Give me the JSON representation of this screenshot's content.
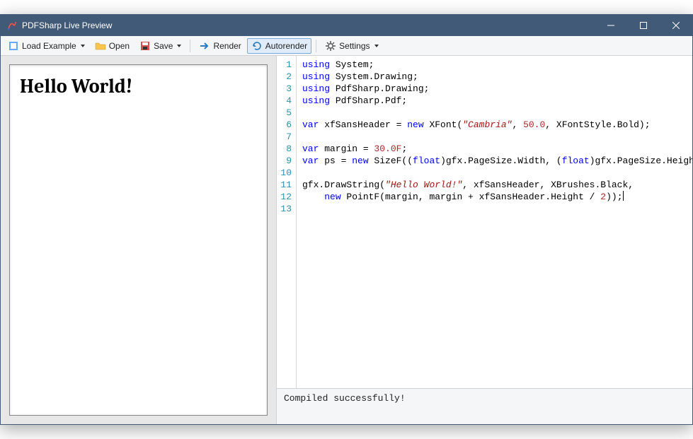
{
  "title": "PDFSharp Live Preview",
  "toolbar": {
    "load_example": "Load Example",
    "open": "Open",
    "save": "Save",
    "render": "Render",
    "autorender": "Autorender",
    "settings": "Settings"
  },
  "preview": {
    "heading": "Hello World!"
  },
  "code": {
    "lines": [
      {
        "n": 1,
        "tokens": [
          [
            "kw",
            "using"
          ],
          [
            "",
            " System;"
          ]
        ]
      },
      {
        "n": 2,
        "tokens": [
          [
            "kw",
            "using"
          ],
          [
            "",
            " System.Drawing;"
          ]
        ]
      },
      {
        "n": 3,
        "tokens": [
          [
            "kw",
            "using"
          ],
          [
            "",
            " PdfSharp.Drawing;"
          ]
        ]
      },
      {
        "n": 4,
        "tokens": [
          [
            "kw",
            "using"
          ],
          [
            "",
            " PdfSharp.Pdf;"
          ]
        ]
      },
      {
        "n": 5,
        "tokens": []
      },
      {
        "n": 6,
        "tokens": [
          [
            "kw",
            "var"
          ],
          [
            "",
            " xfSansHeader = "
          ],
          [
            "kw",
            "new"
          ],
          [
            "",
            " XFont("
          ],
          [
            "str it",
            "\"Cambria\""
          ],
          [
            "",
            ", "
          ],
          [
            "num",
            "50.0"
          ],
          [
            "",
            ", XFontStyle.Bold);"
          ]
        ]
      },
      {
        "n": 7,
        "tokens": []
      },
      {
        "n": 8,
        "tokens": [
          [
            "kw",
            "var"
          ],
          [
            "",
            " margin = "
          ],
          [
            "num",
            "30.0F"
          ],
          [
            "",
            ";"
          ]
        ]
      },
      {
        "n": 9,
        "tokens": [
          [
            "kw",
            "var"
          ],
          [
            "",
            " ps = "
          ],
          [
            "kw",
            "new"
          ],
          [
            "",
            " SizeF(("
          ],
          [
            "kw",
            "float"
          ],
          [
            "",
            ")gfx.PageSize.Width, ("
          ],
          [
            "kw",
            "float"
          ],
          [
            "",
            ")gfx.PageSize.Height);"
          ]
        ]
      },
      {
        "n": 10,
        "tokens": []
      },
      {
        "n": 11,
        "tokens": [
          [
            "",
            "gfx.DrawString("
          ],
          [
            "str it",
            "\"Hello World!\""
          ],
          [
            "",
            ", xfSansHeader, XBrushes.Black,"
          ]
        ]
      },
      {
        "n": 12,
        "tokens": [
          [
            "",
            "    "
          ],
          [
            "kw",
            "new"
          ],
          [
            "",
            " PointF(margin, margin + xfSansHeader.Height / "
          ],
          [
            "num",
            "2"
          ],
          [
            "",
            "));"
          ],
          [
            "cursor",
            ""
          ]
        ]
      },
      {
        "n": 13,
        "tokens": []
      }
    ]
  },
  "status": "Compiled successfully!"
}
